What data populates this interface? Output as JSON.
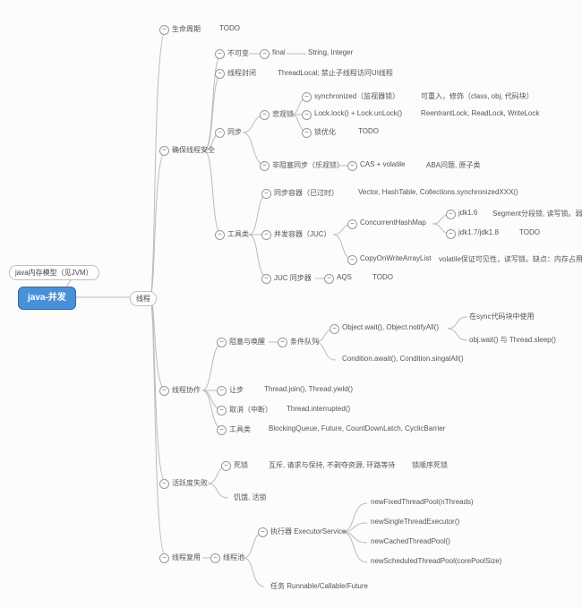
{
  "root": "java-并发",
  "aux": "java内存模型（见JVM）",
  "thread": "线程",
  "c1": {
    "label": "生命周期",
    "note": "TODO"
  },
  "c2": {
    "label": "确保线程安全",
    "immutable": {
      "label": "不可变",
      "sub": "final",
      "note": "String, Integer"
    },
    "closure": {
      "label": "线程封闭",
      "note": "ThreadLocal; 禁止子线程访问UI线程"
    },
    "sync": {
      "label": "同步",
      "pess": {
        "label": "悲观锁",
        "s1": {
          "label": "synchronized（监视器锁）",
          "note": "可重入，修饰（class, obj, 代码块）"
        },
        "s2": {
          "label": "Lock.lock() + Lock.unLock()",
          "note": "ReentrantLock, ReadLock, WriteLock"
        },
        "s3": {
          "label": "锁优化",
          "note": "TODO"
        }
      },
      "opt": {
        "label": "非阻塞同步（乐观锁）",
        "sub": "CAS + volatile",
        "note": "ABA问题, 原子类"
      }
    },
    "tools": {
      "label": "工具类",
      "t1": {
        "label": "同步容器（已过时）",
        "note": "Vector, HashTable, Collections.synchronizedXXX()"
      },
      "juc": {
        "label": "并发容器（JUC）",
        "chm": {
          "label": "ConcurrentHashMap",
          "v1": {
            "label": "jdk1.6",
            "note": "Segment分段锁, 读写锁。弱一致性"
          },
          "v2": {
            "label": "jdk1.7/jdk1.8",
            "note": "TODO"
          }
        },
        "cow": {
          "label": "CopyOnWriteArrayList",
          "note": "volatile保证可见性，读写锁。缺点：内存占用，弱一致性。"
        }
      },
      "syncer": {
        "label": "JUC 同步器",
        "sub": "AQS",
        "note": "TODO"
      }
    }
  },
  "c3": {
    "label": "线程协作",
    "block": {
      "label": "阻塞与唤醒",
      "cond": "条件队列",
      "o1": {
        "label": "Object.wait(), Object.notifyAll()",
        "n1": "在sync代码块中使用",
        "n2": "obj.wait() 与 Thread.sleep()"
      },
      "o2": "Condition.await(), Condition.singalAll()"
    },
    "yield": {
      "label": "让步",
      "note": "Thread.join(), Thread.yield()"
    },
    "cancel": {
      "label": "取消（中断）",
      "note": "Thread.interrupted()"
    },
    "util": {
      "label": "工具类",
      "note": "BlockingQueue, Future, CountDownLatch, CyclicBarrier"
    }
  },
  "c4": {
    "label": "活跃度失败",
    "dead": {
      "label": "死锁",
      "note": "互斥, 请求与保持, 不剥夺资源, 环路等待",
      "extra": "锁顺序死锁"
    },
    "starve": "饥饿, 活锁"
  },
  "c5": {
    "label": "线程复用",
    "pool": "线程池",
    "exec": {
      "label": "执行器 ExecutorService",
      "e1": "newFixedThreadPool(nThreads)",
      "e2": "newSingleThreadExecutor()",
      "e3": "newCachedThreadPool()",
      "e4": "newScheduledThreadPool(corePoolSize)"
    },
    "task": "任务 Runnable/Callable/Future"
  }
}
